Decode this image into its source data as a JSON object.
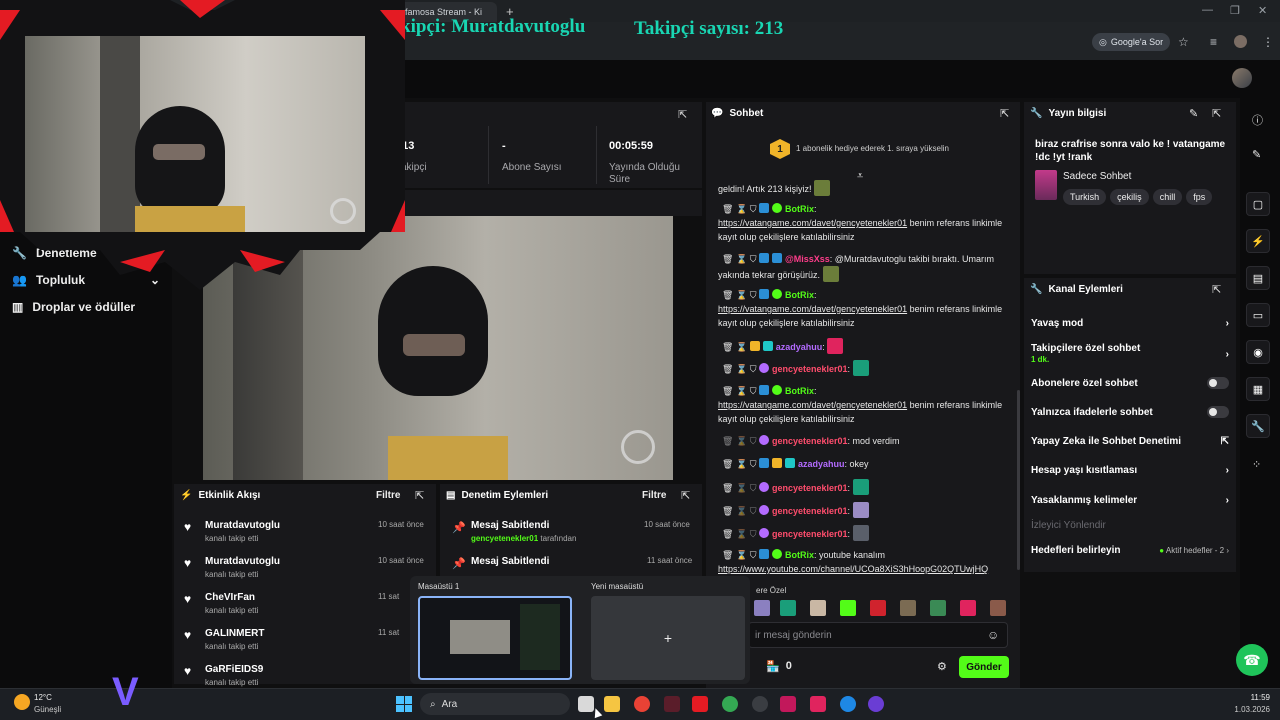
{
  "browser": {
    "tab_title": "afamosa Stream - Ki",
    "google_label": "Google'a Sor"
  },
  "overlay": {
    "follower_text": "kipçi: Muratdavutoglu",
    "count_text": "Takipçi sayısı: 213"
  },
  "leftnav": {
    "items": [
      {
        "label": "Denetleme"
      },
      {
        "label": "Topluluk"
      },
      {
        "label": "Droplar ve ödüller"
      }
    ]
  },
  "stats": [
    {
      "value": "213",
      "label": "Takipçi"
    },
    {
      "value": "-",
      "label": "Abone Sayısı"
    },
    {
      "value": "00:05:59",
      "label": "Yayında Olduğu Süre"
    }
  ],
  "events": {
    "title": "Etkinlik Akışı",
    "filter": "Filtre",
    "items": [
      {
        "name": "Muratdavutoglu",
        "sub": "kanalı takip etti",
        "time": "10 saat önce"
      },
      {
        "name": "Muratdavutoglu",
        "sub": "kanalı takip etti",
        "time": "10 saat önce"
      },
      {
        "name": "CheVIrFan",
        "sub": "kanalı takip etti",
        "time": "11 sat"
      },
      {
        "name": "GALINMERT",
        "sub": "kanalı takip etti",
        "time": "11 sat"
      },
      {
        "name": "GaRFiEIDS9",
        "sub": "kanalı takip etti",
        "time": ""
      }
    ]
  },
  "moderation": {
    "title": "Denetim Eylemleri",
    "filter": "Filtre",
    "items": [
      {
        "name": "Mesaj Sabitlendi",
        "user": "gencyetenekler01",
        "suffix": "tarafından",
        "time": "10 saat önce"
      },
      {
        "name": "Mesaj Sabitlendi",
        "user": "",
        "suffix": "",
        "time": "11 saat önce"
      }
    ]
  },
  "chat": {
    "title": "Sohbet",
    "rank_badge": "1",
    "rank_text": "1 abonelik hediye ederek 1. sıraya yükselin",
    "first_line": "geldin! Artık 213 kişiyiz!",
    "botrix": "BotRix",
    "ref_link": "https://vatangame.com/davet/gencyetenekler01",
    "ref_rest": "benim referans linkimle kayıt olup çekilişlere katılabilirsiniz",
    "missxss": "@MissXss",
    "missxss_text": "@Muratdavutoglu takibi bıraktı. Umarım yakında tekrar görüşürüz.",
    "azady": "azadyahuu",
    "genc": "gencyetenekler01",
    "mod_text": "mod verdim",
    "okey_text": "okey",
    "yt_text": "youtube kanalım",
    "yt_link": "https://www.youtube.com/channel/UCOa8XiS3hHoopG02QTUwjHQ",
    "emote_label": "ere Özel",
    "input_placeholder": "ir mesaj gönderin",
    "points": "0",
    "send": "Gönder"
  },
  "yayin": {
    "title": "Yayın bilgisi",
    "desc": "biraz crafrise sonra valo ke ! vatangame !dc !yt !rank",
    "category": "Sadece Sohbet",
    "tags": [
      "Turkish",
      "çekiliş",
      "chill",
      "fps"
    ]
  },
  "kanal": {
    "title": "Kanal Eylemleri",
    "rows": [
      {
        "label": "Yavaş mod"
      },
      {
        "label": "Takipçilere özel sohbet",
        "sub": "1 dk."
      },
      {
        "label": "Abonelere özel sohbet"
      },
      {
        "label": "Yalnızca ifadelerle sohbet"
      },
      {
        "label": "Yapay Zeka ile Sohbet Denetimi"
      },
      {
        "label": "Hesap yaşı kısıtlaması"
      },
      {
        "label": "Yasaklanmış kelimeler"
      },
      {
        "label": "İzleyici Yönlendir"
      },
      {
        "label": "Hedefleri belirleyin",
        "extra": "Aktif hedefler - 2"
      }
    ]
  },
  "taskview": {
    "desktop1": "Masaüstü 1",
    "desktop2": "Yeni masaüstü",
    "plus": "+"
  },
  "taskbar": {
    "temp": "12°C",
    "weather": "Güneşli",
    "search": "Ara",
    "time": "11:59",
    "date": "1.03.2026"
  }
}
